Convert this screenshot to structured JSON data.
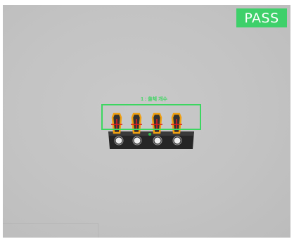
{
  "result": {
    "status": "PASS",
    "status_color": "#3ed06a"
  },
  "inspection": {
    "roi_label": "1 : 쏠체 개수",
    "box_color": "#3cd660",
    "detected_count": 4,
    "marker_color": "#e02020",
    "part_highlight_color": "#f0a010"
  }
}
